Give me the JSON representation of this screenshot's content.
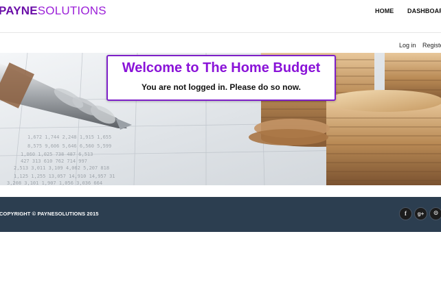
{
  "header": {
    "brand_strong": "PAYNE",
    "brand_light": "SOLUTIONS",
    "nav": {
      "home": "HOME",
      "dashboard": "DASHBOARD"
    }
  },
  "subbar": {
    "login": "Log in",
    "register": "Register"
  },
  "hero": {
    "title": "Welcome to The Home Budget",
    "subtitle": "You are not logged in. Please do so now."
  },
  "footer": {
    "copyright": "COPYRIGHT © PAYNESOLUTIONS 2015",
    "social": {
      "facebook_glyph": "f",
      "google_plus_glyph": "g+",
      "github_glyph": "⊙"
    }
  },
  "colors": {
    "brand": "#6b0fa8",
    "accent": "#8a13d8",
    "footer_bg": "#2c3e50"
  }
}
